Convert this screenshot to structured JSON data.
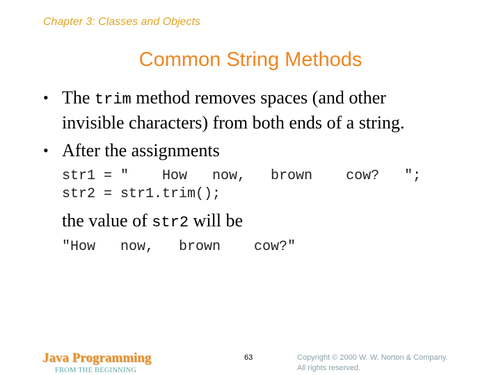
{
  "header": {
    "chapter": "Chapter 3: Classes and Objects",
    "title": "Common String Methods"
  },
  "bullets": [
    {
      "line1_prefix": "The ",
      "line1_code": "trim",
      "line1_suffix": " method removes spaces (and other",
      "line2": "invisible characters) from both ends of a string."
    },
    {
      "text": "After the assignments"
    }
  ],
  "code": {
    "line1": "str1 = \"    How   now,   brown    cow?   \";",
    "line2": "str2 = str1.trim();"
  },
  "value_sentence": {
    "prefix": "the value of ",
    "code": "str2",
    "suffix": " will be"
  },
  "result": "\"How   now,   brown    cow?\"",
  "footer": {
    "brand": "Java Programming",
    "subtitle": "FROM THE BEGINNING",
    "page_number": "63",
    "copyright_line1": "Copyright © 2000 W. W. Norton & Company.",
    "copyright_line2": "All rights reserved."
  },
  "colors": {
    "chapter": "#e0a526",
    "title": "#ee8622",
    "brand": "#e8902a",
    "subtitle": "#5fa8a6",
    "copyright": "#8aa0a8"
  }
}
